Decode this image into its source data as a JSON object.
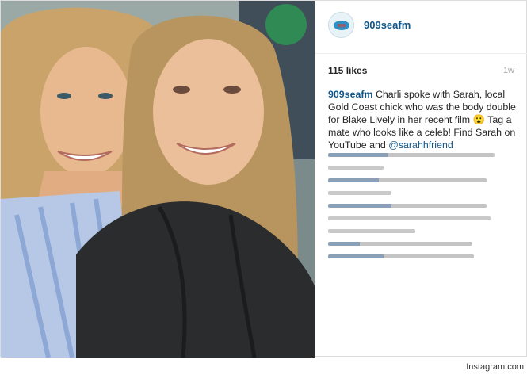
{
  "post": {
    "username": "909seafm",
    "likes": "115 likes",
    "time": "1w",
    "caption_user": "909seafm",
    "caption_text": "Charli spoke with Sarah, local Gold Coast chick who was the body double for Blake Lively in her recent film",
    "caption_emoji": "😮",
    "caption_text_2": "Tag a mate who looks like a celeb! Find Sarah on YouTube and",
    "caption_mention": "@sarahhfriend"
  },
  "avatar_icon": "radio-logo-icon",
  "photo_description_icon": "selfie-photo",
  "watermark": "Instagram.com",
  "colors": {
    "link": "#125688",
    "text": "#262626",
    "muted": "#a5a7aa",
    "blurred_user": "#8aa0b8",
    "blurred_text": "#c4c4c4"
  }
}
